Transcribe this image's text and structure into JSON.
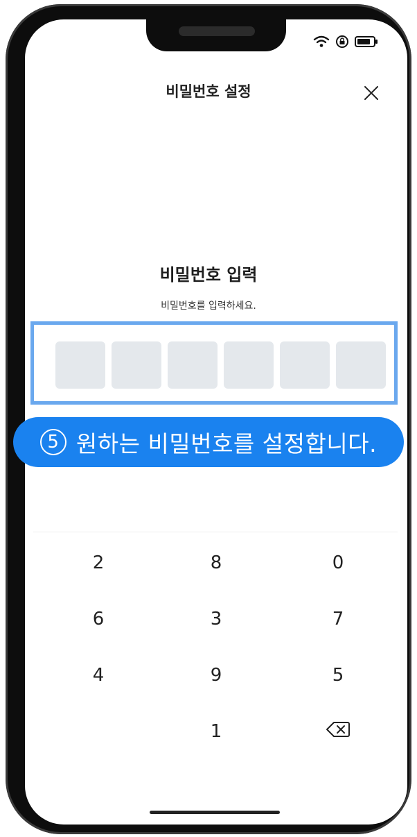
{
  "header": {
    "title": "비밀번호 설정"
  },
  "main": {
    "title": "비밀번호 입력",
    "subtitle": "비밀번호를 입력하세요."
  },
  "tooltip": {
    "number": "5",
    "text": "원하는 비밀번호를 설정합니다."
  },
  "keypad": {
    "keys": [
      "2",
      "8",
      "0",
      "6",
      "3",
      "7",
      "4",
      "9",
      "5",
      "1"
    ]
  },
  "icons": {
    "status": [
      "wifi-icon",
      "lock-rotation-icon",
      "battery-icon"
    ],
    "close": "close-icon",
    "backspace": "backspace-icon"
  },
  "colors": {
    "accent": "#1a82ef",
    "highlight_border": "#6aa8ee",
    "pin_slot": "#e4e8ec"
  }
}
